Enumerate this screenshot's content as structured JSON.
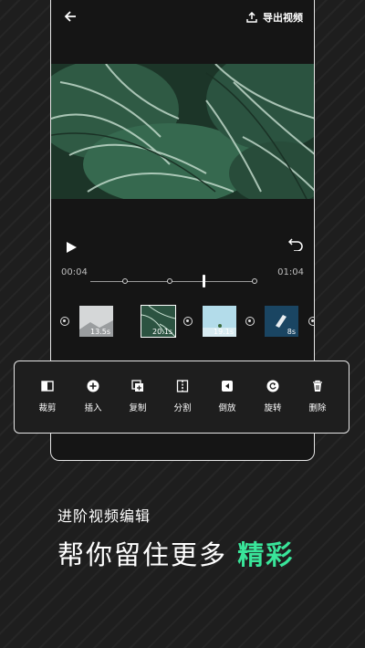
{
  "header": {
    "export_label": "导出视频"
  },
  "player": {
    "time_current": "00:04",
    "time_total": "01:04"
  },
  "clips": [
    {
      "duration": "13.5s"
    },
    {
      "duration": "20.1s"
    },
    {
      "duration": "19.1s"
    },
    {
      "duration": "8s"
    }
  ],
  "tools": [
    {
      "label": "裁剪",
      "icon": "crop-icon"
    },
    {
      "label": "插入",
      "icon": "insert-icon"
    },
    {
      "label": "复制",
      "icon": "copy-icon"
    },
    {
      "label": "分割",
      "icon": "split-icon"
    },
    {
      "label": "倒放",
      "icon": "reverse-icon"
    },
    {
      "label": "旋转",
      "icon": "rotate-icon"
    },
    {
      "label": "删除",
      "icon": "delete-icon"
    }
  ],
  "promo": {
    "subtitle": "进阶视频编辑",
    "headline_prefix": "帮你留住更多",
    "headline_highlight": "精彩"
  },
  "colors": {
    "accent": "#39e59a",
    "background": "#1e1e1e"
  }
}
